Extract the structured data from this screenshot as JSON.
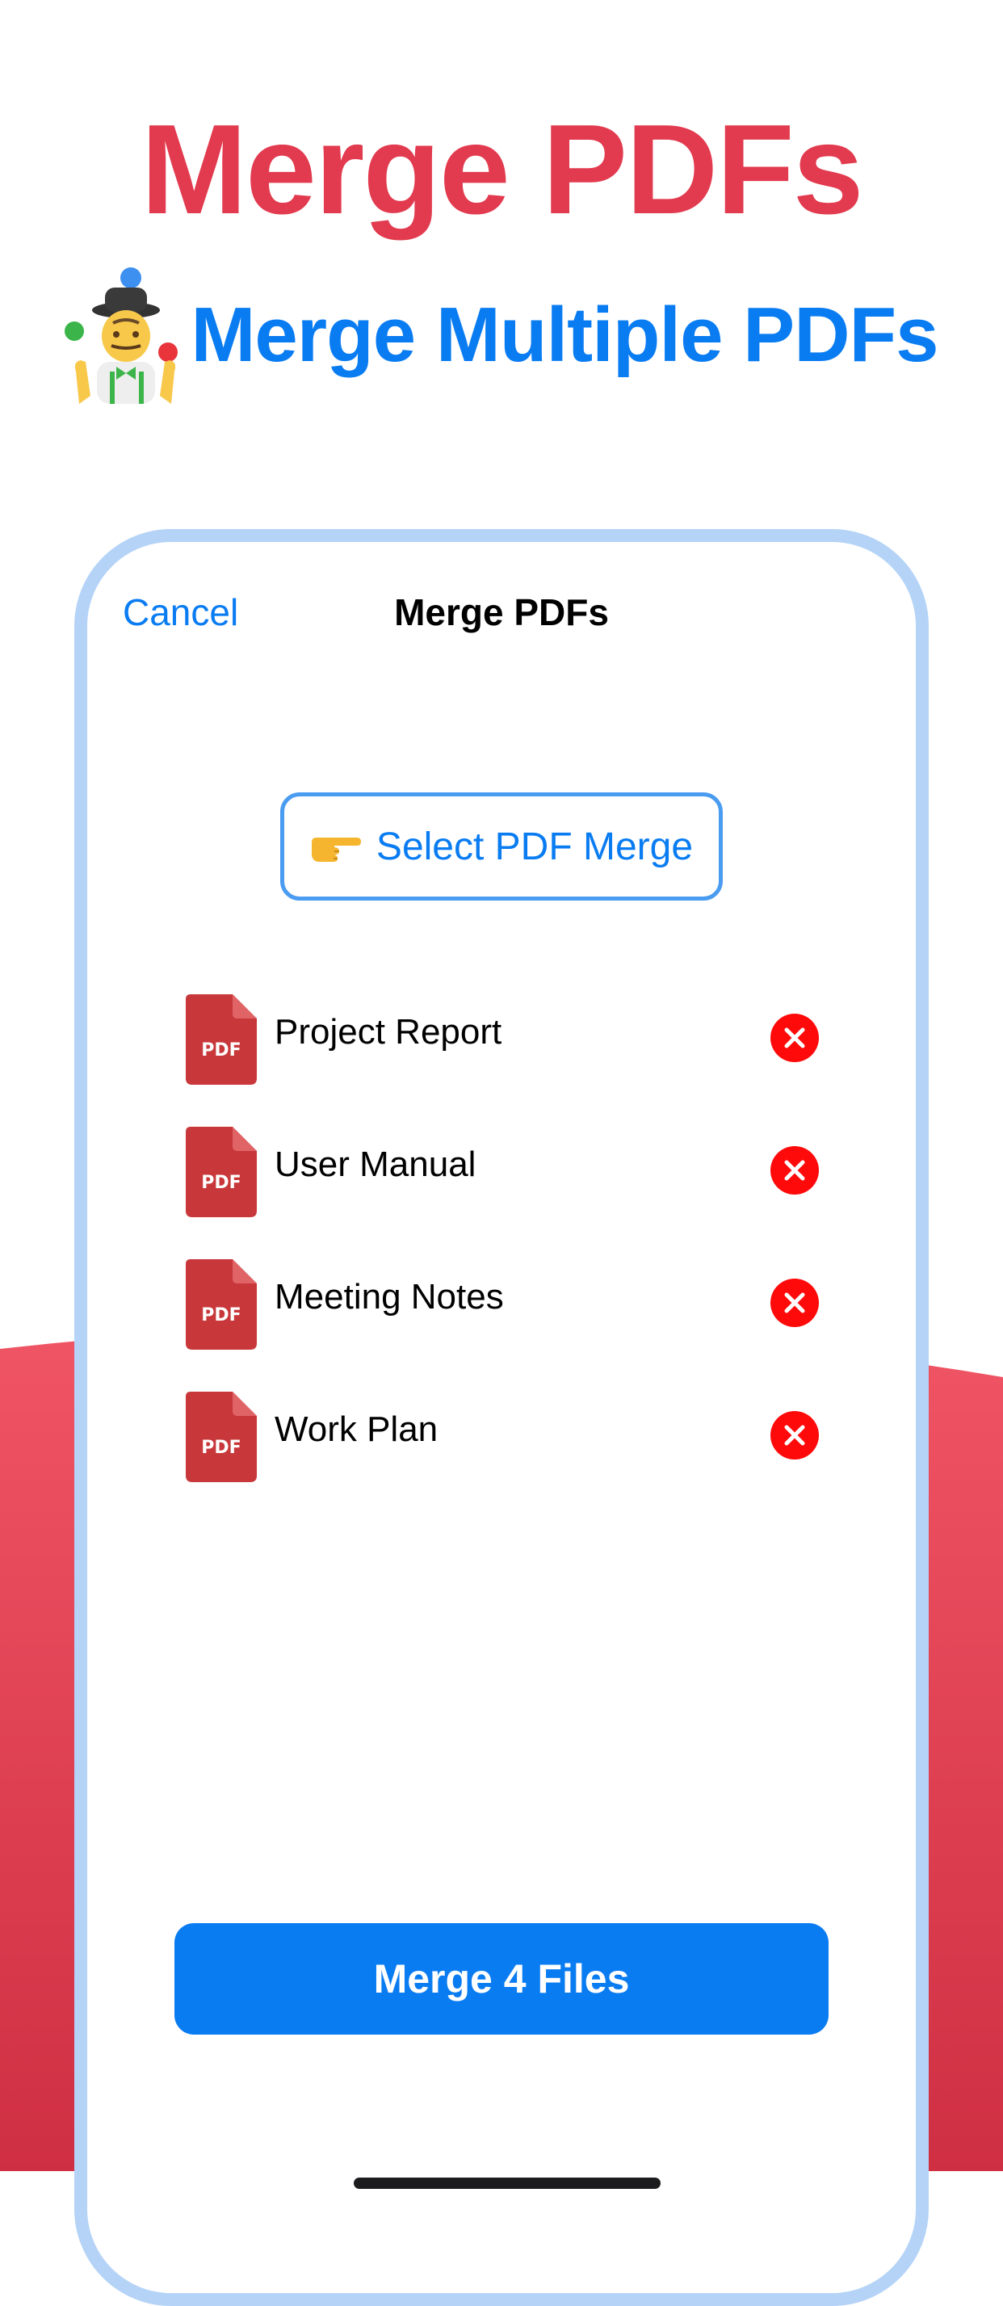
{
  "headline": "Merge PDFs",
  "subheadline": {
    "icon": "juggler-icon",
    "text": "Merge Multiple PDFs"
  },
  "nav": {
    "cancel_label": "Cancel",
    "title": "Merge PDFs"
  },
  "select_button": {
    "icon": "pointing-hand-icon",
    "label": "Select PDF Merge"
  },
  "files": [
    {
      "name": "Project Report",
      "icon_label": "PDF"
    },
    {
      "name": "User Manual",
      "icon_label": "PDF"
    },
    {
      "name": "Meeting Notes",
      "icon_label": "PDF"
    },
    {
      "name": "Work Plan",
      "icon_label": "PDF"
    }
  ],
  "merge_button": {
    "label": "Merge 4 Files"
  },
  "colors": {
    "headline": "#e23a4e",
    "accent_blue": "#0a7cf2",
    "frame_border": "#b4d3f7",
    "pdf_red": "#c8373a",
    "remove_red": "#ff0a0a",
    "background_curve": "#e0404f"
  }
}
